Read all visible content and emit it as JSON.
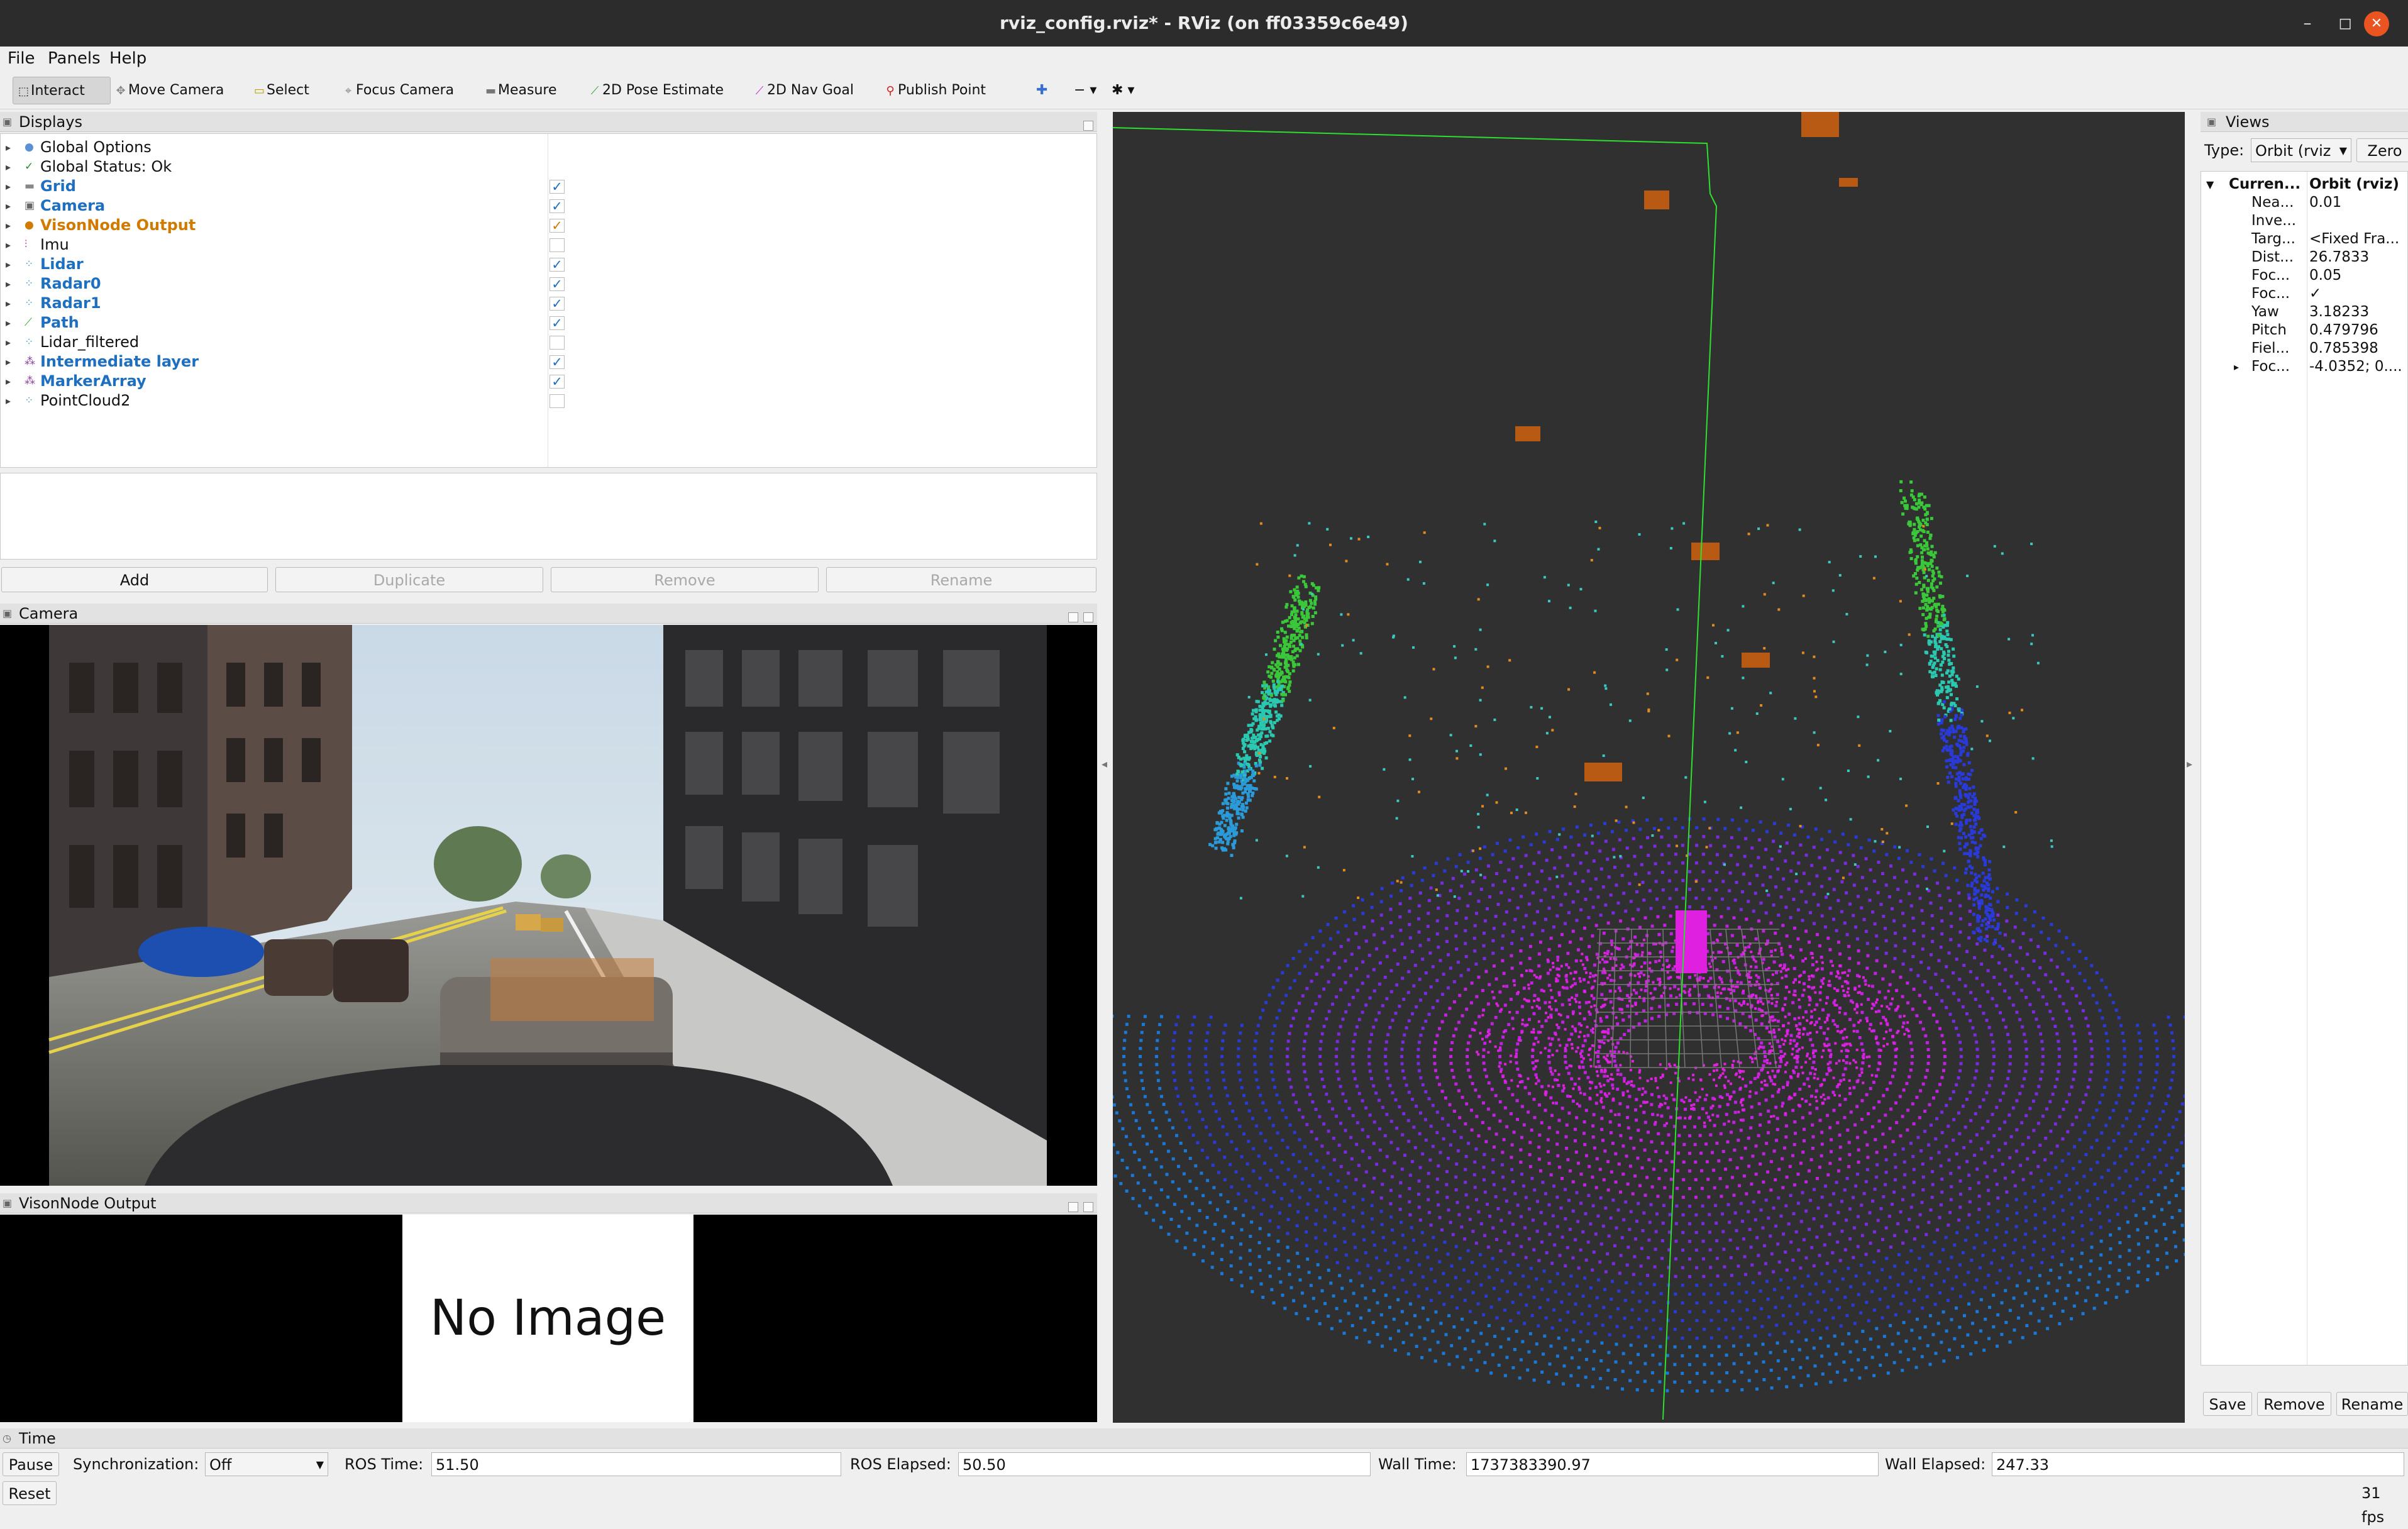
{
  "window": {
    "title": "rviz_config.rviz* - RViz (on ff03359c6e49)",
    "minimize": "–",
    "maximize": "◻",
    "close": "✕"
  },
  "menubar": {
    "file": "File",
    "panels": "Panels",
    "help": "Help"
  },
  "toolbar": {
    "interact": "Interact",
    "move_camera": "Move Camera",
    "select": "Select",
    "focus_camera": "Focus Camera",
    "measure": "Measure",
    "pose_estimate": "2D Pose Estimate",
    "nav_goal": "2D Nav Goal",
    "publish_point": "Publish Point"
  },
  "displays": {
    "title": "Displays",
    "items": [
      {
        "label": "Global Options",
        "icon": "globe-icon",
        "checked": null,
        "style": "normal"
      },
      {
        "label": "Global Status: Ok",
        "icon": "check-icon",
        "checked": null,
        "style": "normal"
      },
      {
        "label": "Grid",
        "icon": "grid-icon",
        "checked": true,
        "style": "blue"
      },
      {
        "label": "Camera",
        "icon": "camera-icon",
        "checked": true,
        "style": "blue"
      },
      {
        "label": "VisonNode Output",
        "icon": "image-icon",
        "checked": true,
        "style": "orange"
      },
      {
        "label": "Imu",
        "icon": "imu-icon",
        "checked": false,
        "style": "normal"
      },
      {
        "label": "Lidar",
        "icon": "pointcloud-icon",
        "checked": true,
        "style": "blue"
      },
      {
        "label": "Radar0",
        "icon": "pointcloud-icon",
        "checked": true,
        "style": "blue"
      },
      {
        "label": "Radar1",
        "icon": "pointcloud-icon",
        "checked": true,
        "style": "blue"
      },
      {
        "label": "Path",
        "icon": "path-icon",
        "checked": true,
        "style": "blue"
      },
      {
        "label": "Lidar_filtered",
        "icon": "pointcloud-icon",
        "checked": false,
        "style": "normal"
      },
      {
        "label": "Intermediate layer",
        "icon": "marker-icon",
        "checked": true,
        "style": "blue"
      },
      {
        "label": "MarkerArray",
        "icon": "marker-icon",
        "checked": true,
        "style": "blue"
      },
      {
        "label": "PointCloud2",
        "icon": "pointcloud-icon",
        "checked": false,
        "style": "normal"
      }
    ],
    "buttons": {
      "add": "Add",
      "duplicate": "Duplicate",
      "remove": "Remove",
      "rename": "Rename"
    }
  },
  "camera_panel": {
    "title": "Camera"
  },
  "vision_panel": {
    "title": "VisonNode Output",
    "placeholder": "No Image"
  },
  "views": {
    "title": "Views",
    "type_label": "Type:",
    "type_value": "Orbit (rviz",
    "zero_button": "Zero",
    "current_label": "Curren...",
    "current_value": "Orbit (rviz)",
    "props": [
      {
        "name": "Nea...",
        "value": "0.01"
      },
      {
        "name": "Inve...",
        "value": ""
      },
      {
        "name": "Targ...",
        "value": "<Fixed Fra..."
      },
      {
        "name": "Dist...",
        "value": "26.7833"
      },
      {
        "name": "Foc...",
        "value": "0.05"
      },
      {
        "name": "Foc...",
        "value": "✓"
      },
      {
        "name": "Yaw",
        "value": "3.18233"
      },
      {
        "name": "Pitch",
        "value": "0.479796"
      },
      {
        "name": "Fiel...",
        "value": "0.785398"
      },
      {
        "name": "Foc...",
        "value": "-4.0352; 0...."
      }
    ],
    "buttons": {
      "save": "Save",
      "remove": "Remove",
      "rename": "Rename"
    }
  },
  "time_panel": {
    "title": "Time",
    "pause": "Pause",
    "sync_label": "Synchronization:",
    "sync_value": "Off",
    "ros_time_label": "ROS Time:",
    "ros_time": "51.50",
    "ros_elapsed_label": "ROS Elapsed:",
    "ros_elapsed": "50.50",
    "wall_time_label": "Wall Time:",
    "wall_time": "1737383390.97",
    "wall_elapsed_label": "Wall Elapsed:",
    "wall_elapsed": "247.33",
    "reset": "Reset",
    "fps": "31 fps"
  },
  "colors": {
    "accent": "#e95420",
    "enabled_blue": "#1e6fbf",
    "warning_orange": "#d07a00",
    "viewport_bg": "#303030"
  }
}
